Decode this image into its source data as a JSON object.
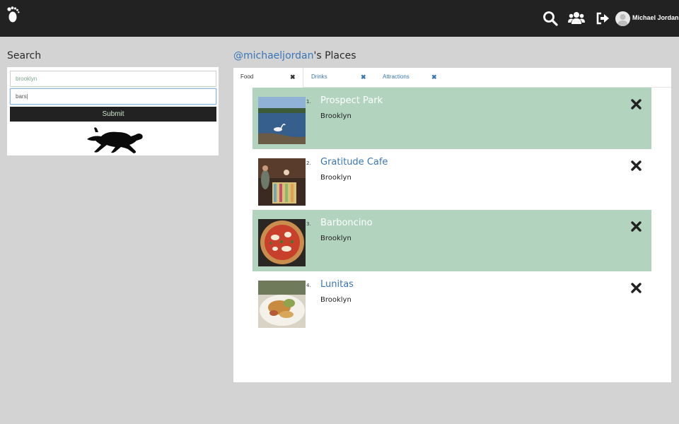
{
  "header": {
    "logo_icon": "footprint-icon",
    "icons": [
      "search-icon",
      "users-icon",
      "logout-icon"
    ],
    "user_name": "Michael Jordan"
  },
  "search": {
    "title": "Search",
    "location_value": "brooklyn",
    "query_value": "bars|",
    "submit_label": "Submit",
    "decor_icon": "running-dog-icon"
  },
  "places": {
    "handle": "@michaeljordan",
    "title_suffix": "'s Places",
    "tabs": [
      {
        "label": "Food",
        "active": true
      },
      {
        "label": "Drinks",
        "active": false
      },
      {
        "label": "Attractions",
        "active": false
      }
    ],
    "items": [
      {
        "rank": "1.",
        "name": "Prospect Park",
        "city": "Brooklyn"
      },
      {
        "rank": "2.",
        "name": "Gratitude Cafe",
        "city": "Brooklyn"
      },
      {
        "rank": "3.",
        "name": "Barboncino",
        "city": "Brooklyn"
      },
      {
        "rank": "4.",
        "name": "Lunitas",
        "city": "Brooklyn"
      }
    ]
  },
  "colors": {
    "topbar": "#232222",
    "accent_link": "#3a76b5",
    "row_highlight": "#b2d3be",
    "background": "#d3d3d3"
  }
}
